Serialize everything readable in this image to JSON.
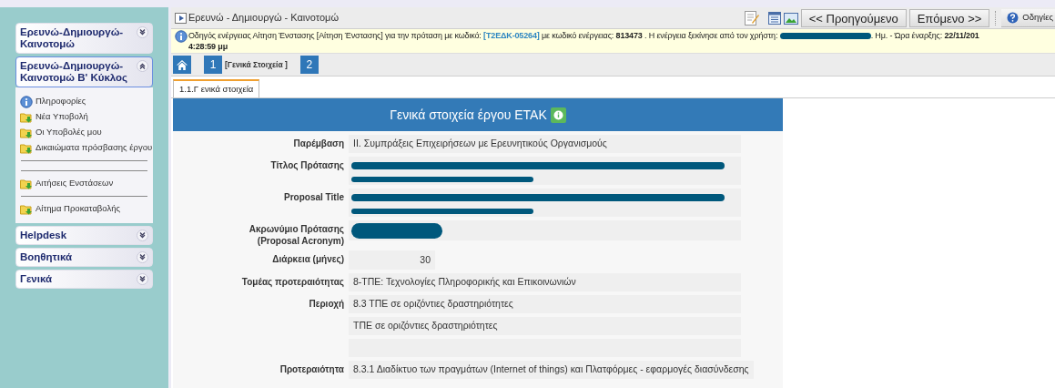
{
  "sidebar": {
    "sections": [
      {
        "title": "Ερευνώ-Δημιουργώ-Καινοτομώ",
        "expanded": false
      },
      {
        "title": "Ερευνώ-Δημιουργώ-Καινοτομώ Β' Κύκλος",
        "expanded": true,
        "items": [
          {
            "kind": "info",
            "label": "Πληροφορίες"
          },
          {
            "kind": "folder",
            "label": "Νέα Υποβολή"
          },
          {
            "kind": "folder",
            "label": "Οι Υποβολές μου"
          },
          {
            "kind": "folder",
            "label": "Δικαιώματα πρόσβασης έργου"
          },
          {
            "kind": "separator"
          },
          {
            "kind": "separator"
          },
          {
            "kind": "folder",
            "label": "Αιτήσεις Ενστάσεων"
          },
          {
            "kind": "separator"
          },
          {
            "kind": "folder",
            "label": "Αίτημα Προκαταβολής"
          }
        ]
      },
      {
        "title": "Helpdesk",
        "expanded": false
      },
      {
        "title": "Βοηθητικά",
        "expanded": false
      },
      {
        "title": "Γενικά",
        "expanded": false
      }
    ]
  },
  "window": {
    "title": "Ερευνώ - Δημιουργώ - Καινοτομώ"
  },
  "toolbar": {
    "previous": "<< Προηγούμενο",
    "next": "Επόμενο >>",
    "help": "Οδηγίες"
  },
  "info_bar": {
    "segments": [
      {
        "kind": "text",
        "text": "Οδηγός ενέργειας Αίτηση Ένστασης [Αίτηση Ένστασης] για την πρόταση με κωδικό: "
      },
      {
        "kind": "code",
        "text": "[Τ2ΕΔΚ-05264]"
      },
      {
        "kind": "text",
        "text": " με κωδικό ενέργειας: "
      },
      {
        "kind": "bold",
        "text": "813473"
      },
      {
        "kind": "text",
        "text": " . Η ενέργεια ξεκίνησε από τον χρήστη: "
      },
      {
        "kind": "redacted"
      },
      {
        "kind": "text",
        "text": ". Ημ. - Ώρα έναρξης: "
      },
      {
        "kind": "bold",
        "text": "22/11/201"
      }
    ],
    "time": "4:28:59 μμ"
  },
  "steps": [
    {
      "number": "1",
      "label": "[Γενικά Στοιχεία ]"
    },
    {
      "number": "2"
    }
  ],
  "tabs": [
    {
      "label": "1.1.Γ ενικά στοιχεία",
      "selected": true
    }
  ],
  "form": {
    "title": "Γενικά στοιχεία έργου ΕΤΑΚ",
    "rows": [
      {
        "label": "Παρέμβαση",
        "kind": "text",
        "value": "ΙΙ. Συμπράξεις Επιχειρήσεων με Ερευνητικούς Οργανισμούς"
      },
      {
        "label": "Τίτλος Πρότασης",
        "kind": "redacted-long"
      },
      {
        "label": "Proposal Title",
        "kind": "redacted-long"
      },
      {
        "label": "Ακρωνύμιο Πρότασης (Proposal Acronym)",
        "kind": "redacted-short"
      },
      {
        "label": "Διάρκεια (μήνες)",
        "kind": "number",
        "value": "30"
      },
      {
        "label": "Τομέας προτεραιότητας",
        "kind": "text",
        "value": "8-ΤΠΕ: Τεχνολογίες Πληροφορικής και Επικοινωνιών"
      },
      {
        "label": "Περιοχή",
        "kind": "text",
        "value": "8.3 ΤΠΕ σε οριζόντιες δραστηριότητες"
      },
      {
        "kind": "text",
        "value": "ΤΠΕ σε οριζόντιες δραστηριότητες"
      },
      {
        "kind": "empty"
      },
      {
        "label": "Προτεραιότητα",
        "kind": "text",
        "value": "8.3.1 Διαδίκτυο των πραγμάτων (Internet of things) και Πλατφόρμες - εφαρμογές διασύνδεσης"
      }
    ]
  }
}
